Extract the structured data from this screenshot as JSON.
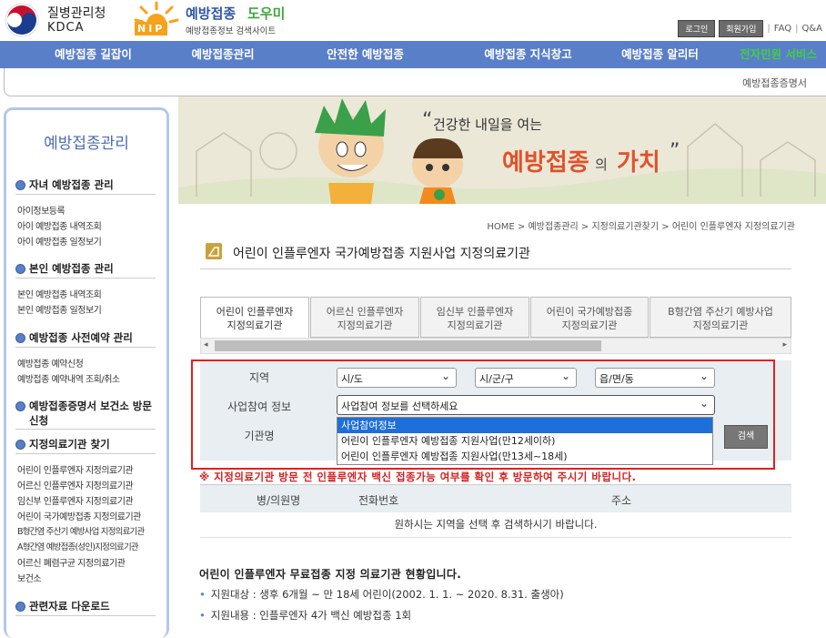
{
  "header": {
    "kdca_name": "질병관리청",
    "kdca_abbr": "KDCA",
    "site_name_a": "예방접종",
    "site_name_b": "도우미",
    "site_subtitle": "예방접종정보 검색사이트",
    "nip_logo": "NIP",
    "login": "로그인",
    "signup": "회원가입",
    "faq": "FAQ",
    "qna": "Q&A",
    "sep": "|"
  },
  "nav": {
    "items": [
      "예방접종 길잡이",
      "예방접종관리",
      "안전한 예방접종",
      "예방접종 지식창고",
      "예방접종 알리터",
      "전자민원 서비스"
    ],
    "sub_item": "예방접종증명서"
  },
  "sidebar": {
    "title": "예방접종관리",
    "sections": [
      {
        "label": "자녀 예방접종 관리",
        "links": [
          "아이정보등록",
          "아이 예방접종 내역조회",
          "아이 예방접종 일정보기"
        ]
      },
      {
        "label": "본인 예방접종 관리",
        "links": [
          "본인 예방접종 내역조회",
          "본인 예방접종 일정보기"
        ]
      },
      {
        "label": "예방접종 사전예약 관리",
        "links": [
          "예방접종 예약신청",
          "예방접종 예약내역 조회/취소"
        ]
      },
      {
        "label": "예방접종증명서 보건소 방문신청",
        "links": []
      },
      {
        "label": "지정의료기관 찾기",
        "links": [
          "어린이 인플루엔자 지정의료기관",
          "어르신 인플루엔자 지정의료기관",
          "임신부 인플루엔자 지정의료기관",
          "어린이 국가예방접종 지정의료기관",
          "B형간염 주산기 예방사업 지정의료기관",
          "A형간염 예방접종(성인)지정의료기관",
          "어르신 폐렴구균 지정의료기관",
          "보건소"
        ]
      },
      {
        "label": "관련자료 다운로드",
        "links": []
      }
    ]
  },
  "banner": {
    "tagline": "건강한 내일을 여는",
    "headline_a": "예방접종",
    "headline_b": "의",
    "headline_c": "가치",
    "open_quote": "“",
    "close_quote": "”"
  },
  "breadcrumb": [
    "HOME",
    "예방접종관리",
    "지정의료기관찾기",
    "어린이 인플루엔자 지정의료기관"
  ],
  "breadcrumb_sep": ">",
  "page_title": "어린이 인플루엔자 국가예방접종 지원사업 지정의료기관",
  "tabs": [
    {
      "line1": "어린이 인플루엔자",
      "line2": "지정의료기관"
    },
    {
      "line1": "어르신 인플루엔자",
      "line2": "지정의료기관"
    },
    {
      "line1": "임신부 인플루엔자",
      "line2": "지정의료기관"
    },
    {
      "line1": "어린이 국가예방접종",
      "line2": "지정의료기관"
    },
    {
      "line1": "B형간염 주산기 예방사업",
      "line2": "지정의료기관"
    }
  ],
  "scroll": {
    "left": "◂",
    "right": "▸"
  },
  "form": {
    "region_label": "지역",
    "sido": "시/도",
    "sigungu": "시/군/구",
    "eupmyeondong": "읍/면/동",
    "program_label": "사업참여 정보",
    "program_placeholder": "사업참여 정보를 선택하세요",
    "institution_label": "기관명",
    "search_button": "검색",
    "dropdown_options": [
      "사업참여정보",
      "어린이 인플루엔자 예방접종 지원사업(만12세이하)",
      "어린이 인플루엔자 예방접종 지원사업(만13세~18세)"
    ],
    "chevron": "⌄"
  },
  "warning": "※ 지정의료기관 방문 전 인플루엔자 백신 접종가능 여부를 확인 후 방문하여 주시기 바랍니다.",
  "table": {
    "headers": [
      "병/의원명",
      "전화번호",
      "주소"
    ],
    "empty_message": "원하시는 지역을 선택 후 검색하시기 바랍니다."
  },
  "info": {
    "title": "어린이 인플루엔자 무료접종 지정 의료기관 현황입니다.",
    "bullets": [
      "지원대상 : 생후 6개월 ~ 만 18세 어린이(2002. 1. 1. ~ 2020. 8.31. 출생아)",
      "지원내용 : 인플루엔자 4가 백신 예방접종 1회"
    ]
  },
  "colors": {
    "nav": "#5a7fc9",
    "accent_green": "#3fd13f",
    "warning_red": "#d42020",
    "highlight_box": "#e02020",
    "selected_option": "#1e6fd9"
  }
}
